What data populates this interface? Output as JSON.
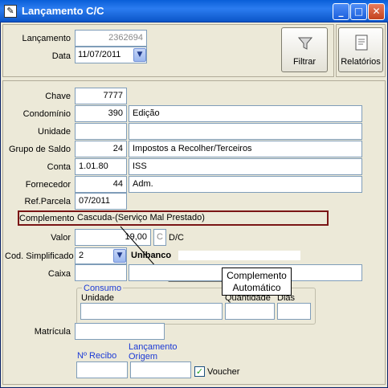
{
  "window": {
    "title": "Lançamento C/C",
    "minimize": "_",
    "maximize": "□",
    "close": "✕"
  },
  "header": {
    "lancamento_label": "Lançamento",
    "lancamento_value": "2362694",
    "data_label": "Data",
    "data_value": "11/07/2011",
    "filtrar_label": "Filtrar",
    "relatorios_label": "Relatórios"
  },
  "form": {
    "chave_label": "Chave",
    "chave_value": "7777",
    "condominio_label": "Condomínio",
    "condominio_code": "390",
    "condominio_name": "Edição",
    "unidade_label": "Unidade",
    "unidade_code": "",
    "unidade_name": "",
    "grupo_label": "Grupo de Saldo",
    "grupo_code": "24",
    "grupo_name": "Impostos a Recolher/Terceiros",
    "conta_label": "Conta",
    "conta_code": "1.01.80",
    "conta_name": "ISS",
    "fornecedor_label": "Fornecedor",
    "fornecedor_code": "44",
    "fornecedor_name": "Adm.",
    "refparcela_label": "Ref.Parcela",
    "refparcela_value": "07/2011",
    "complemento_label": "Complemento",
    "complemento_value": "Cascuda-(Serviço Mal Prestado)",
    "valor_label": "Valor",
    "valor_value": "19,00",
    "valor_flag": "C",
    "dc_label": "D/C",
    "codsimp_label": "Cod. Simplificado",
    "codsimp_value": "2",
    "codsimp_name": "Unibanco",
    "caixa_label": "Caixa",
    "consumo_label": "Consumo",
    "consumo_unidade_label": "Unidade",
    "consumo_quantidade_label": "Quantidade",
    "consumo_dias_label": "Dias",
    "matricula_label": "Matrícula",
    "recibo_label": "Nº Recibo",
    "lanc_origem_label_1": "Lançamento",
    "lanc_origem_label_2": "Origem",
    "voucher_label": "Voucher"
  },
  "tooltip": {
    "line1": "Complemento",
    "line2": "Automático"
  },
  "icons": {
    "app": "grid-icon",
    "filter": "funnel-icon",
    "report": "report-icon",
    "combo": "chevron-down-icon",
    "check": "checkmark-icon"
  },
  "colors": {
    "titlebar": "#0a5fd8",
    "highlight_border": "#7a1515",
    "blue_label": "#1c3ad6",
    "selection": "#316ac5"
  }
}
